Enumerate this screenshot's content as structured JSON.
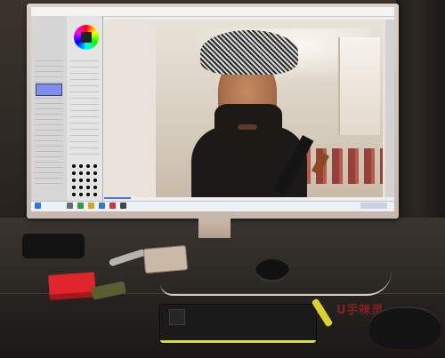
{
  "scene": {
    "desk_mat_logo": "ᑌ手咪灵"
  },
  "colors": {
    "desk_mat_red": "#8a1f1f",
    "tablet_accent": "#d6de3a",
    "selection_blue": "#4d74d9"
  }
}
